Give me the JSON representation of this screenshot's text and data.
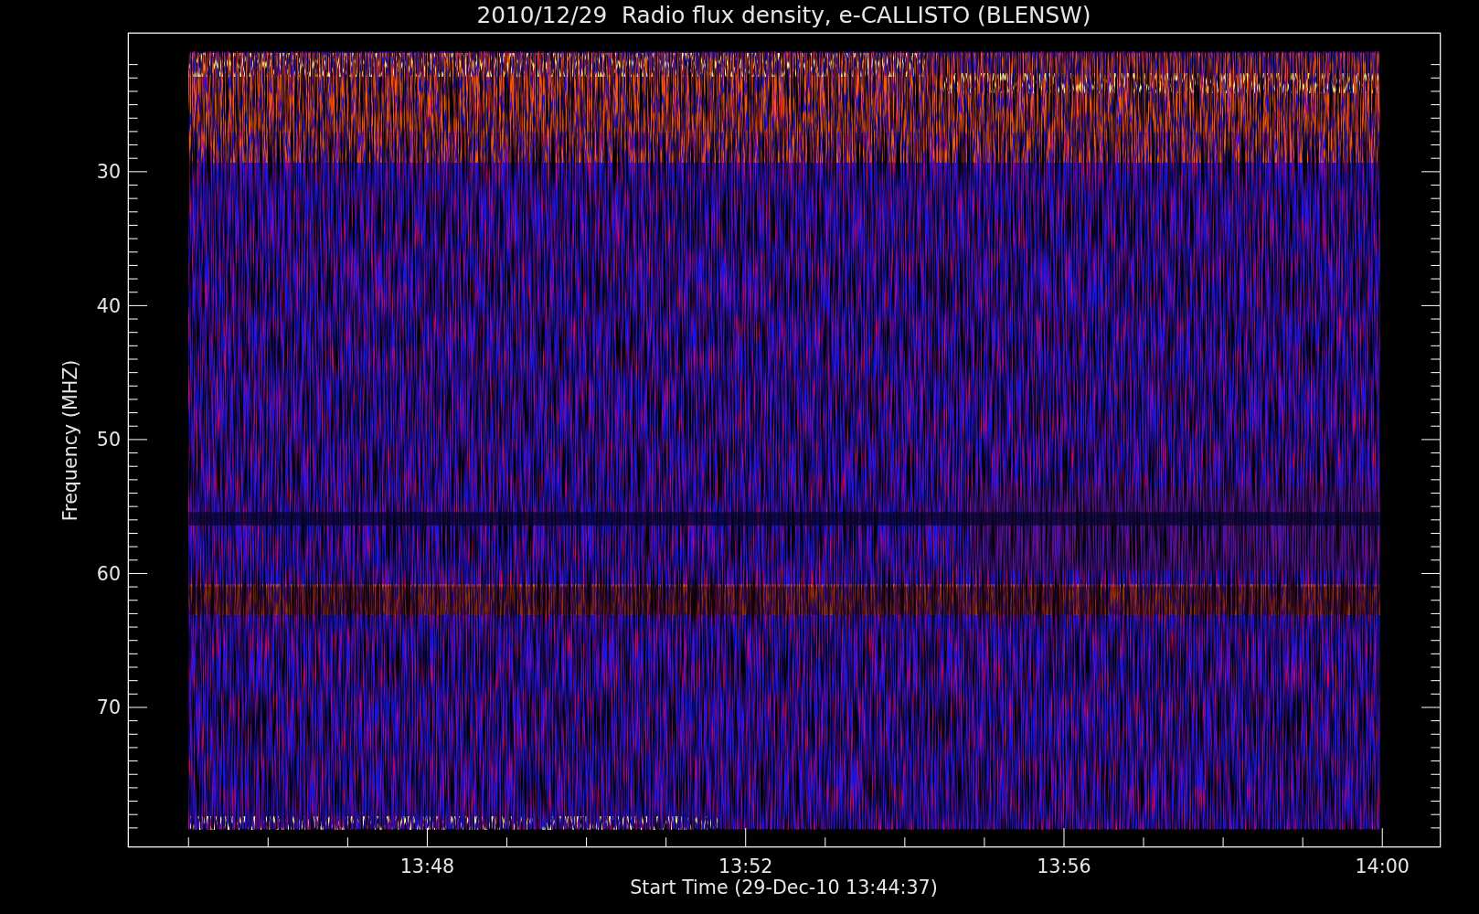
{
  "title": "2010/12/29  Radio flux density, e-CALLISTO (BLENSW)",
  "y_axis": {
    "label": "Frequency (MHZ)",
    "ticks": [
      "30",
      "40",
      "50",
      "60",
      "70"
    ]
  },
  "x_axis": {
    "label": "Start Time (29-Dec-10 13:44:37)",
    "ticks": [
      "13:48",
      "13:52",
      "13:56",
      "14:00"
    ]
  }
}
